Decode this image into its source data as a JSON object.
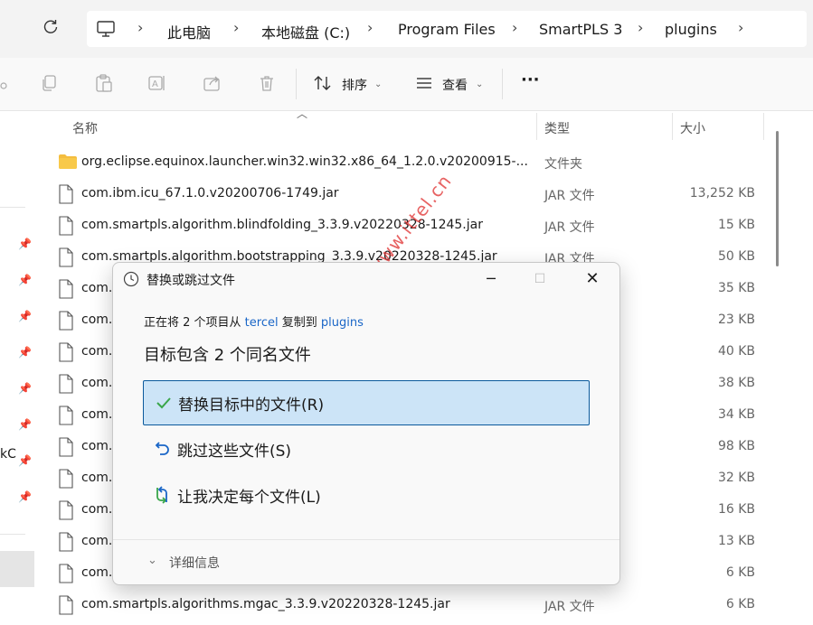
{
  "breadcrumbs": [
    "此电脑",
    "本地磁盘 (C:)",
    "Program Files",
    "SmartPLS 3",
    "plugins"
  ],
  "toolbar": {
    "sort_label": "排序",
    "view_label": "查看",
    "more_label": "···"
  },
  "columns": {
    "name": "名称",
    "type": "类型",
    "size": "大小"
  },
  "files": [
    {
      "name": "org.eclipse.equinox.launcher.win32.win32.x86_64_1.2.0.v20200915-...",
      "type": "文件夹",
      "size": "",
      "icon": "folder-icon"
    },
    {
      "name": "com.ibm.icu_67.1.0.v20200706-1749.jar",
      "type": "JAR 文件",
      "size": "13,252 KB",
      "icon": "file-icon"
    },
    {
      "name": "com.smartpls.algorithm.blindfolding_3.3.9.v20220328-1245.jar",
      "type": "JAR 文件",
      "size": "15 KB",
      "icon": "file-icon"
    },
    {
      "name": "com.smartpls.algorithm.bootstrapping_3.3.9.v20220328-1245.jar",
      "type": "JAR 文件",
      "size": "50 KB",
      "icon": "file-icon"
    },
    {
      "name": "com.",
      "type": "",
      "size": "35 KB",
      "icon": "file-icon"
    },
    {
      "name": "com.",
      "type": "",
      "size": "23 KB",
      "icon": "file-icon"
    },
    {
      "name": "com.",
      "type": "",
      "size": "40 KB",
      "icon": "file-icon"
    },
    {
      "name": "com.",
      "type": "",
      "size": "38 KB",
      "icon": "file-icon"
    },
    {
      "name": "com.",
      "type": "",
      "size": "34 KB",
      "icon": "file-icon"
    },
    {
      "name": "com.",
      "type": "",
      "size": "98 KB",
      "icon": "file-icon"
    },
    {
      "name": "com.",
      "type": "",
      "size": "32 KB",
      "icon": "file-icon"
    },
    {
      "name": "com.",
      "type": "",
      "size": "16 KB",
      "icon": "file-icon"
    },
    {
      "name": "com.",
      "type": "",
      "size": "13 KB",
      "icon": "file-icon"
    },
    {
      "name": "com.",
      "type": "",
      "size": "6 KB",
      "icon": "file-icon"
    },
    {
      "name": "com.smartpls.algorithms.mgac_3.3.9.v20220328-1245.jar",
      "type": "JAR 文件",
      "size": "6 KB",
      "icon": "file-icon"
    }
  ],
  "sidebar": {
    "clipped_label": "kC"
  },
  "dialog": {
    "title": "替换或跳过文件",
    "subtitle_prefix": "正在将 2 个项目从 ",
    "source": "tercel",
    "subtitle_mid": " 复制到 ",
    "destination": "plugins",
    "heading": "目标包含 2 个同名文件",
    "options": [
      {
        "label": "替换目标中的文件(R)",
        "icon": "checkmark-icon"
      },
      {
        "label": "跳过这些文件(S)",
        "icon": "skip-arrow-icon"
      },
      {
        "label": "让我决定每个文件(L)",
        "icon": "decide-icon"
      }
    ],
    "details_label": "详细信息"
  },
  "watermark": "IT技术之家www.ittel.cn",
  "colors": {
    "accent": "#0b5a9c",
    "selected_bg": "#cce4f7",
    "link": "#1a66c7",
    "folder": "#f4bd3f",
    "watermark": "#e03030"
  }
}
